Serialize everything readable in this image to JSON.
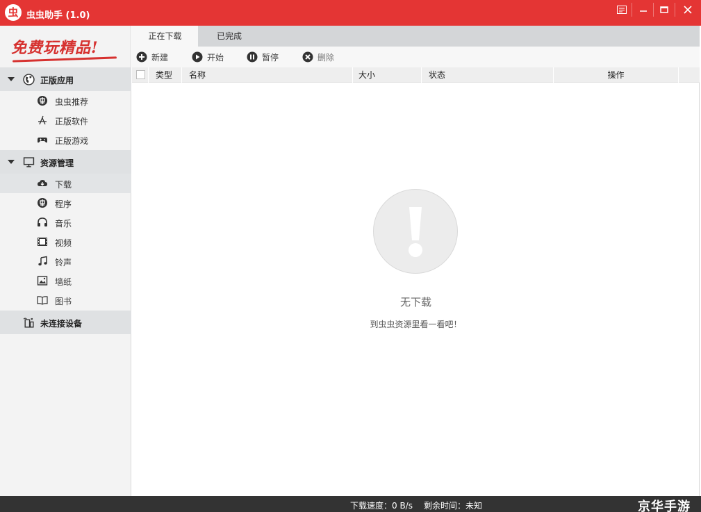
{
  "app": {
    "logo_text": "虫",
    "title": "虫虫助手 (1.0)"
  },
  "window_controls": [
    "menu-icon",
    "minimize-icon",
    "maximize-icon",
    "close-icon"
  ],
  "sidebar": {
    "slogan": "免费玩精品!",
    "groups": [
      {
        "label": "正版应用",
        "icon": "globe-icon",
        "items": [
          {
            "label": "虫虫推荐",
            "icon": "bug-logo-icon"
          },
          {
            "label": "正版软件",
            "icon": "app-store-icon"
          },
          {
            "label": "正版游戏",
            "icon": "gamepad-icon"
          }
        ]
      },
      {
        "label": "资源管理",
        "icon": "monitor-icon",
        "items": [
          {
            "label": "下载",
            "icon": "cloud-download-icon",
            "active": true
          },
          {
            "label": "程序",
            "icon": "bug-logo-icon"
          },
          {
            "label": "音乐",
            "icon": "headphones-icon"
          },
          {
            "label": "视频",
            "icon": "film-icon"
          },
          {
            "label": "铃声",
            "icon": "music-note-icon"
          },
          {
            "label": "墙纸",
            "icon": "picture-icon"
          },
          {
            "label": "图书",
            "icon": "book-icon"
          }
        ]
      },
      {
        "label": "未连接设备",
        "icon": "device-icon",
        "items": []
      }
    ]
  },
  "tabs": [
    {
      "label": "正在下载",
      "active": true
    },
    {
      "label": "已完成",
      "active": false
    }
  ],
  "toolbar": {
    "new_label": "新建",
    "start_label": "开始",
    "pause_label": "暂停",
    "delete_label": "删除"
  },
  "table": {
    "columns": [
      "类型",
      "名称",
      "大小",
      "状态",
      "操作"
    ],
    "rows": []
  },
  "empty_state": {
    "title": "无下载",
    "subtitle": "到虫虫资源里看一看吧！"
  },
  "status_bar": {
    "speed": "下载速度：0 B/s",
    "remaining": "剩余时间：未知",
    "watermark": "京华手游"
  },
  "colors": {
    "brand_red": "#e43534",
    "status_bar": "#333333",
    "sidebar_bg": "#f3f3f3"
  }
}
